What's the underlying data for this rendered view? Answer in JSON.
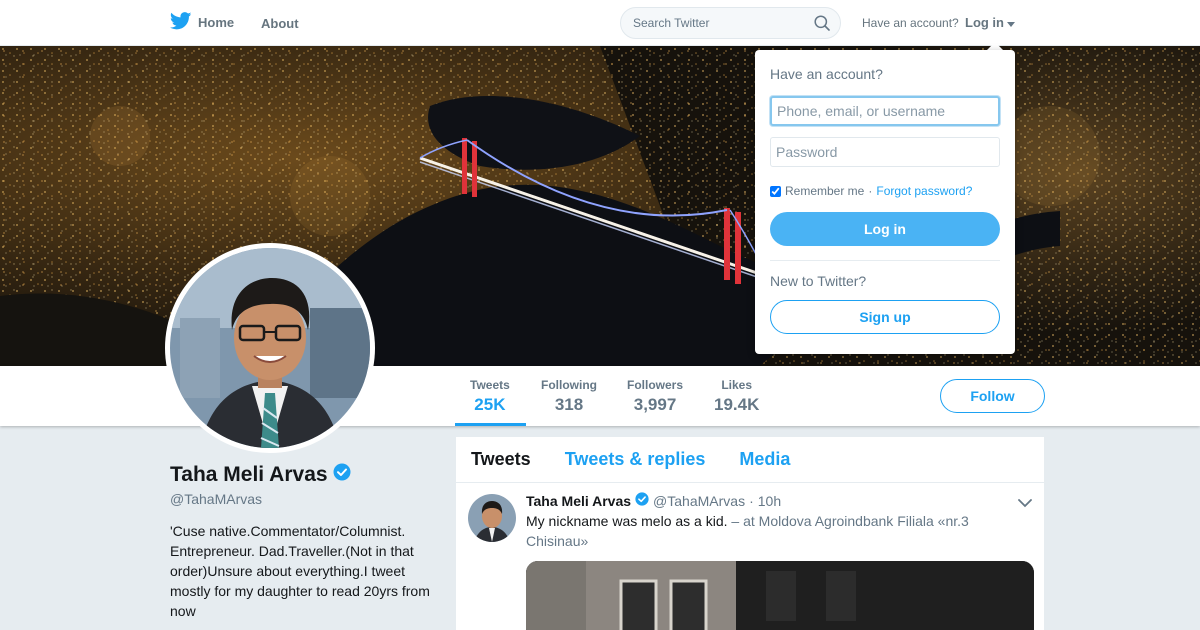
{
  "colors": {
    "accent": "#1da1f2",
    "page_bg": "#e6ecf0",
    "login_button": "#4ab3f4"
  },
  "nav": {
    "logo_icon": "twitter-bird-icon",
    "home_label": "Home",
    "about_label": "About",
    "search_placeholder": "Search Twitter",
    "have_account_text": "Have an account?",
    "login_label": "Log in"
  },
  "login_dropdown": {
    "title": "Have an account?",
    "username_placeholder": "Phone, email, or username",
    "password_placeholder": "Password",
    "remember_label": "Remember me",
    "separator": "·",
    "forgot_label": "Forgot password?",
    "login_button": "Log in",
    "new_prompt": "New to Twitter?",
    "signup_button": "Sign up"
  },
  "profile": {
    "name": "Taha Meli Arvas",
    "handle": "@TahaMArvas",
    "verified_icon": "verified-badge-icon",
    "bio": "'Cuse native.Commentator/Columnist. Entrepreneur. Dad.Traveller.(Not in that order)Unsure about everything.I tweet mostly for my daughter to read 20yrs from now",
    "stats": [
      {
        "label": "Tweets",
        "value": "25K"
      },
      {
        "label": "Following",
        "value": "318"
      },
      {
        "label": "Followers",
        "value": "3,997"
      },
      {
        "label": "Likes",
        "value": "19.4K"
      }
    ],
    "follow_button": "Follow"
  },
  "timeline": {
    "tabs": [
      "Tweets",
      "Tweets & replies",
      "Media"
    ],
    "tweet": {
      "author": "Taha Meli Arvas",
      "handle": "@TahaMArvas",
      "dot": "·",
      "time": "10h",
      "text": "My nickname was melo as a kid.",
      "location": "– at Moldova Agroindbank Filiala «nr.3 Chisinau»"
    }
  }
}
